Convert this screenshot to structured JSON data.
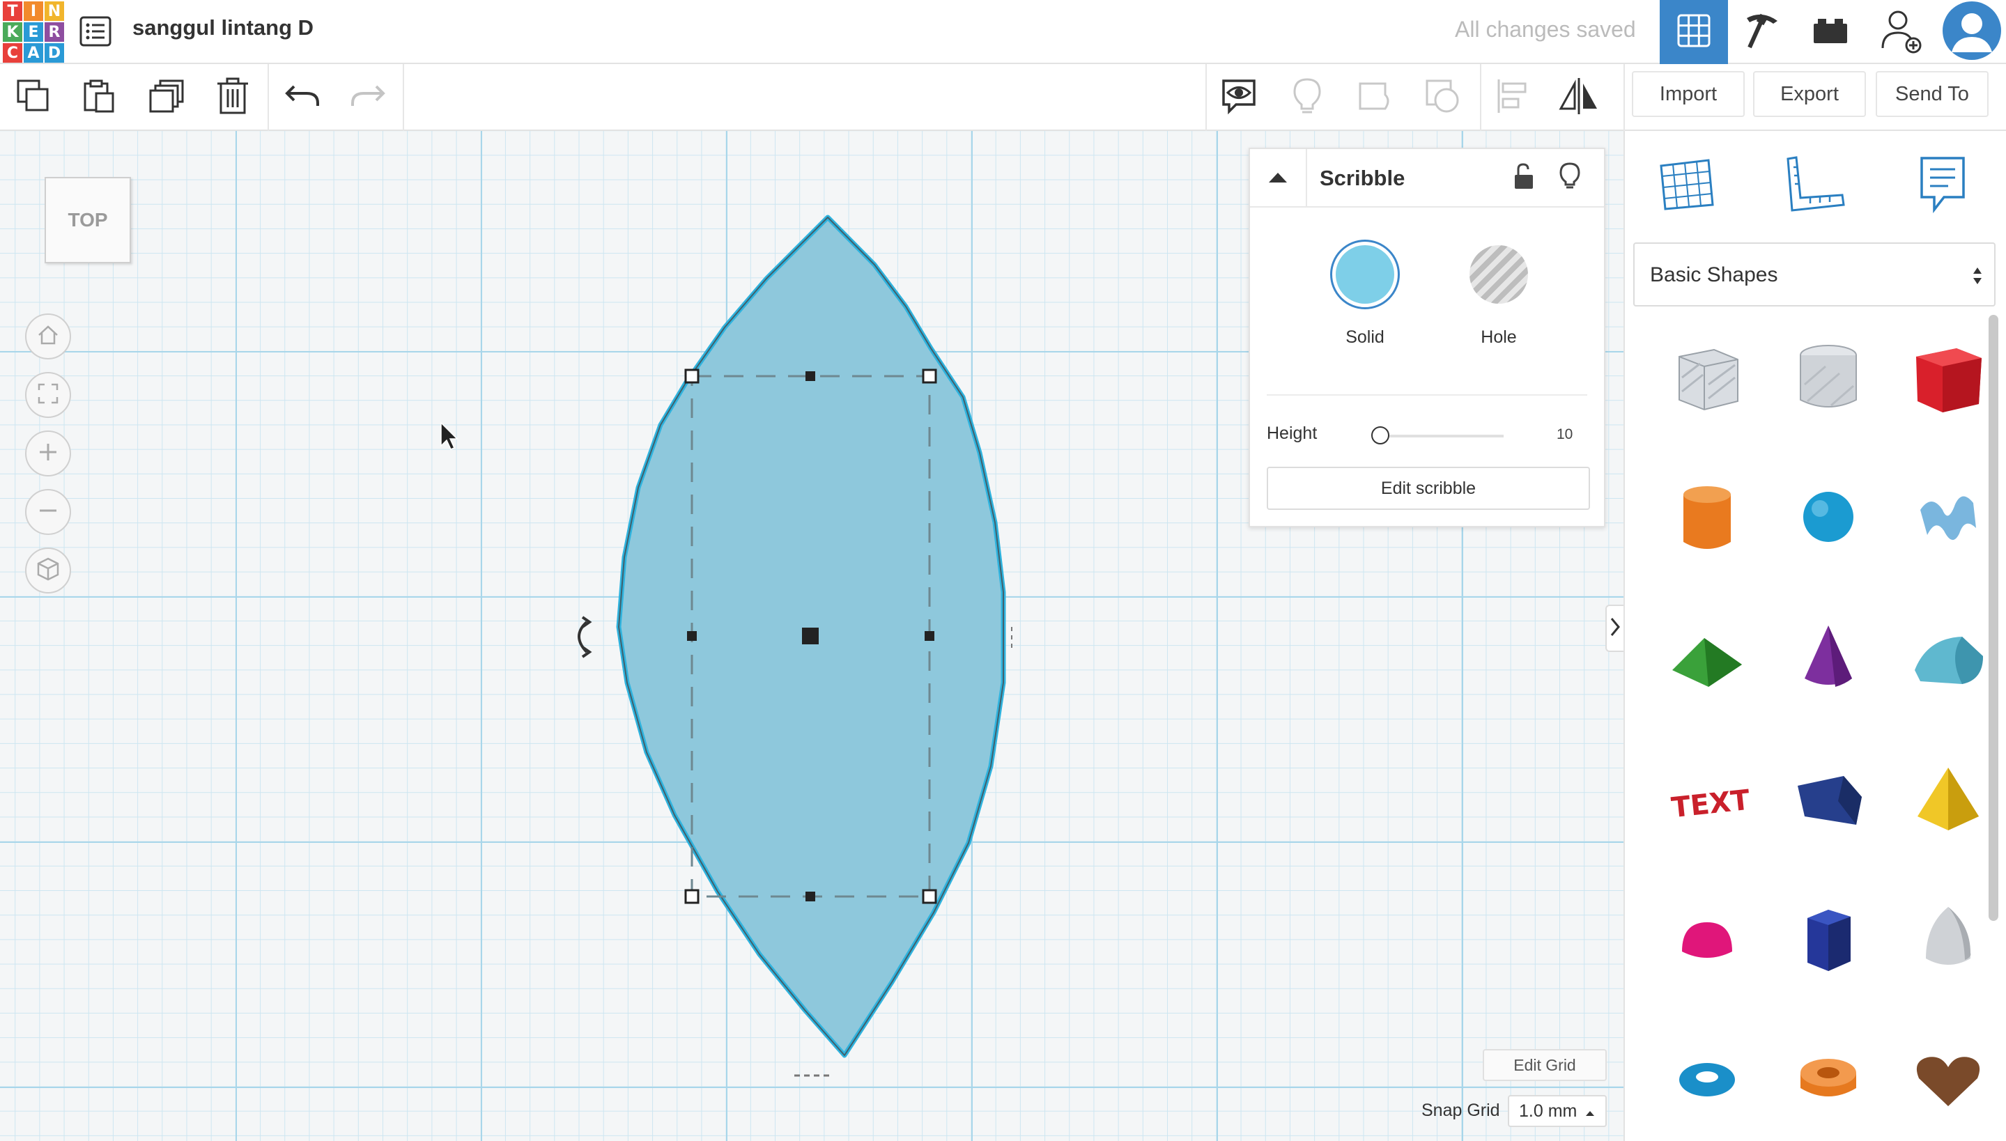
{
  "app": {
    "logo_letters": [
      "T",
      "I",
      "N",
      "K",
      "E",
      "R",
      "C",
      "A",
      "D"
    ],
    "logo_colors": [
      "#e8403b",
      "#f28a2c",
      "#f1b52c",
      "#4aaa5a",
      "#2a9ad6",
      "#8e4ea0",
      "#e8403b",
      "#2a9ad6",
      "#2a9ad6"
    ],
    "design_title": "sanggul lintang D",
    "save_status": "All changes saved"
  },
  "header_buttons": [
    {
      "name": "3d-design-view-button",
      "icon": "grid-view-icon",
      "active": true
    },
    {
      "name": "blocks-view-button",
      "icon": "pickaxe-icon",
      "active": false
    },
    {
      "name": "bricks-view-button",
      "icon": "brick-icon",
      "active": false
    },
    {
      "name": "share-user-button",
      "icon": "add-user-icon",
      "active": false
    },
    {
      "name": "profile-button",
      "icon": "avatar-icon",
      "active": false
    }
  ],
  "toolbar": {
    "left_tools": [
      {
        "name": "copy-button",
        "icon": "copy-icon"
      },
      {
        "name": "paste-button",
        "icon": "paste-icon"
      },
      {
        "name": "duplicate-button",
        "icon": "duplicate-icon"
      },
      {
        "name": "delete-button",
        "icon": "trash-icon"
      },
      {
        "name": "undo-button",
        "icon": "undo-icon"
      },
      {
        "name": "redo-button",
        "icon": "redo-icon",
        "disabled": true
      }
    ],
    "right_tools": [
      {
        "name": "notes-visibility-button",
        "icon": "eye-bubble-icon"
      },
      {
        "name": "show-all-button",
        "icon": "lightbulb-icon",
        "disabled": true
      },
      {
        "name": "group-button",
        "icon": "group-icon",
        "disabled": true
      },
      {
        "name": "ungroup-button",
        "icon": "ungroup-icon",
        "disabled": true
      },
      {
        "name": "align-button",
        "icon": "align-icon",
        "disabled": true
      },
      {
        "name": "mirror-button",
        "icon": "mirror-icon"
      }
    ],
    "import_label": "Import",
    "export_label": "Export",
    "send_to_label": "Send To"
  },
  "viewport": {
    "view_cube_label": "TOP",
    "nav_buttons": [
      "home-view-icon",
      "fit-all-icon",
      "zoom-in-icon",
      "zoom-out-icon",
      "perspective-icon"
    ]
  },
  "inspector": {
    "shape_name": "Scribble",
    "solid_label": "Solid",
    "hole_label": "Hole",
    "solid_color": "#7ecfe8",
    "height_label": "Height",
    "height_value": "10",
    "edit_button_label": "Edit scribble"
  },
  "library": {
    "category": "Basic Shapes",
    "tabs": [
      "workplane-icon",
      "ruler-icon",
      "notes-icon"
    ],
    "shapes": [
      {
        "name": "box-hole-shape",
        "color": "#b8bec6"
      },
      {
        "name": "cylinder-hole-shape",
        "color": "#c3c8ce"
      },
      {
        "name": "box-shape",
        "color": "#d9202b"
      },
      {
        "name": "cylinder-shape",
        "color": "#e97a1f"
      },
      {
        "name": "sphere-shape",
        "color": "#1b9bd1"
      },
      {
        "name": "scribble-shape",
        "color": "#7ab6de"
      },
      {
        "name": "roof-shape",
        "color": "#3aa13a"
      },
      {
        "name": "cone-shape",
        "color": "#7d2f9e"
      },
      {
        "name": "round-roof-shape",
        "color": "#5fb8cf"
      },
      {
        "name": "text-shape",
        "color": "#c9202b"
      },
      {
        "name": "shape-generator",
        "color": "#263f8c"
      },
      {
        "name": "pyramid-shape",
        "color": "#f0c727"
      },
      {
        "name": "half-sphere-shape",
        "color": "#e0167a"
      },
      {
        "name": "polygon-shape",
        "color": "#25379a"
      },
      {
        "name": "paraboloid-shape",
        "color": "#cfd2d6"
      },
      {
        "name": "torus-shape",
        "color": "#1a8fc9"
      },
      {
        "name": "tube-shape",
        "color": "#e6791f"
      },
      {
        "name": "heart-shape",
        "color": "#7a4a2a"
      }
    ]
  },
  "grid": {
    "edit_grid_label": "Edit Grid",
    "snap_grid_label": "Snap Grid",
    "snap_grid_value": "1.0 mm"
  },
  "colors": {
    "accent": "#3b86c9",
    "shape_fill": "#8ec8dc",
    "selection_outline": "#2fb3de"
  }
}
